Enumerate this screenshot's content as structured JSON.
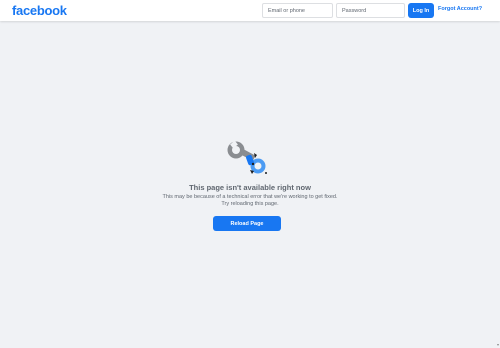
{
  "header": {
    "logo": "facebook",
    "email_placeholder": "Email or phone",
    "password_placeholder": "Password",
    "login_label": "Log In",
    "forgot_label": "Forgot Account?"
  },
  "error": {
    "icon": "broken-wrench-illustration",
    "title": "This page isn't available right now",
    "description": "This may be because of a technical error that we're working to get fixed. Try reloading this page.",
    "reload_label": "Reload Page"
  },
  "colors": {
    "brand": "#1877f2",
    "background": "#f0f2f5",
    "muted_text": "#606770"
  }
}
